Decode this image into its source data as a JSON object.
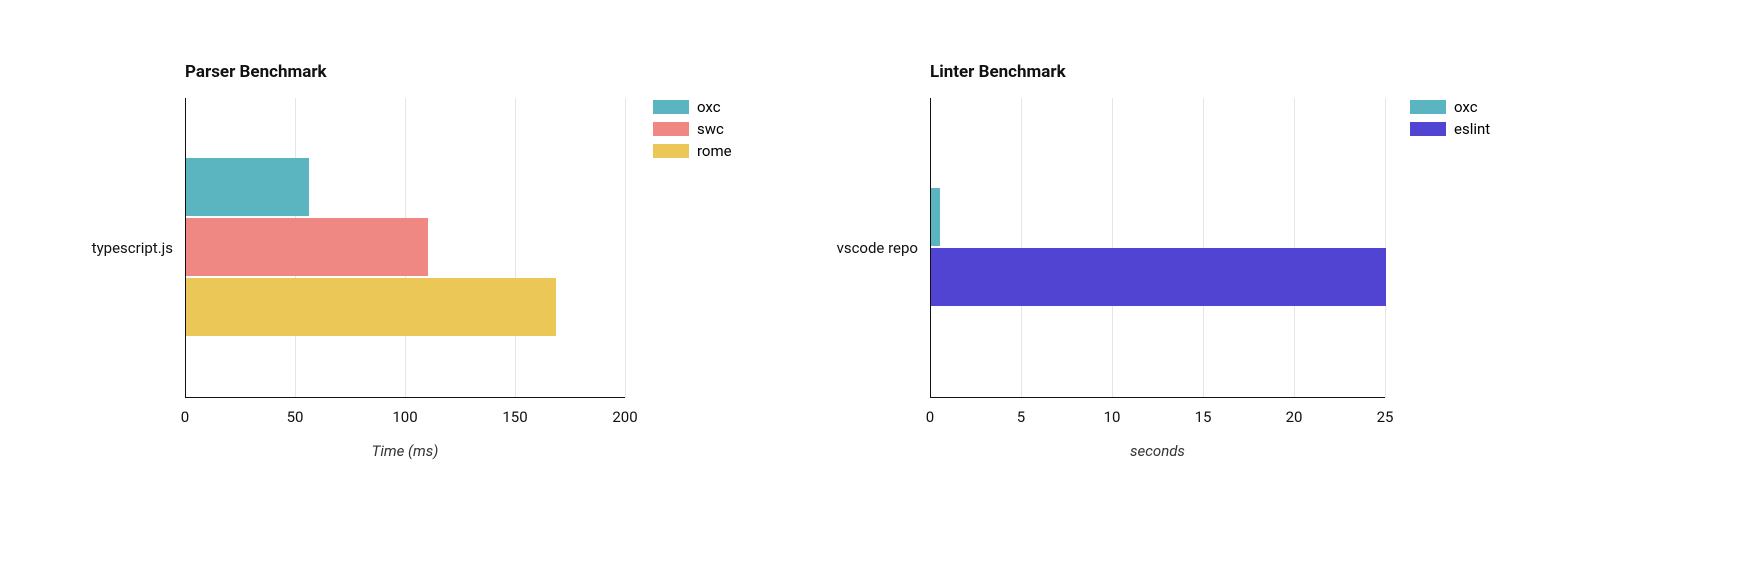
{
  "chart_data": [
    {
      "type": "bar",
      "orientation": "horizontal",
      "title": "Parser Benchmark",
      "categories": [
        "typescript.js"
      ],
      "xlabel": "Time (ms)",
      "ylabel": "",
      "xlim": [
        0,
        200
      ],
      "xticks": [
        0,
        50,
        100,
        150,
        200
      ],
      "series": [
        {
          "name": "oxc",
          "color": "#5bb5c0",
          "values": [
            56
          ]
        },
        {
          "name": "swc",
          "color": "#ef8783",
          "values": [
            110
          ]
        },
        {
          "name": "rome",
          "color": "#eac756",
          "values": [
            168
          ]
        }
      ]
    },
    {
      "type": "bar",
      "orientation": "horizontal",
      "title": "Linter Benchmark",
      "categories": [
        "vscode repo"
      ],
      "xlabel": "seconds",
      "ylabel": "",
      "xlim": [
        0,
        25
      ],
      "xticks": [
        0,
        5,
        10,
        15,
        20,
        25
      ],
      "series": [
        {
          "name": "oxc",
          "color": "#5bb5c0",
          "values": [
            0.5
          ]
        },
        {
          "name": "eslint",
          "color": "#5144d3",
          "values": [
            25
          ]
        }
      ]
    }
  ]
}
